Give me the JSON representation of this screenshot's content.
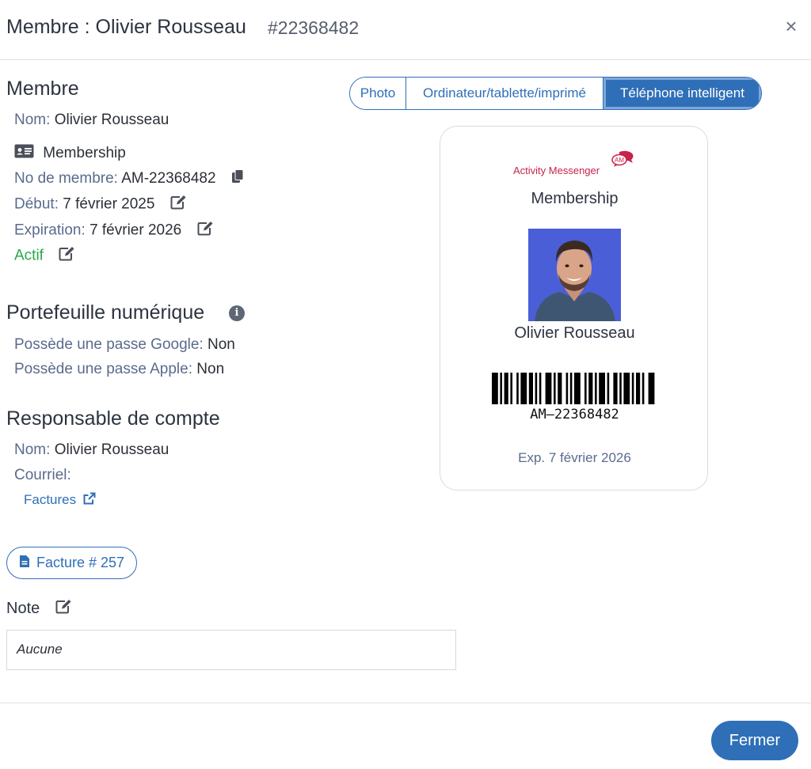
{
  "header": {
    "title": "Membre : Olivier Rousseau",
    "member_id": "#22368482",
    "close_label": "×"
  },
  "member": {
    "section_title": "Membre",
    "name_label": "Nom:",
    "name_value": "Olivier Rousseau",
    "membership_type": "Membership",
    "number_label": "No de membre:",
    "number_value": "AM-22368482",
    "start_label": "Début:",
    "start_value": "7 février 2025",
    "expiration_label": "Expiration:",
    "expiration_value": "7 février 2026",
    "status": "Actif"
  },
  "wallet": {
    "section_title": "Portefeuille numérique",
    "google_label": "Possède une passe Google:",
    "google_value": "Non",
    "apple_label": "Possède une passe Apple:",
    "apple_value": "Non"
  },
  "account_manager": {
    "section_title": "Responsable de compte",
    "name_label": "Nom:",
    "name_value": "Olivier Rousseau",
    "email_label": "Courriel:",
    "invoices_link": "Factures"
  },
  "invoice_button": "Facture # 257",
  "note": {
    "label": "Note",
    "value": "Aucune"
  },
  "view_tabs": [
    {
      "label": "Photo",
      "active": false
    },
    {
      "label": "Ordinateur/tablette/imprimé",
      "active": false
    },
    {
      "label": "Téléphone intelligent",
      "active": true
    }
  ],
  "card": {
    "brand": "Activity Messenger",
    "brand_badge": "AM",
    "title": "Membership",
    "name": "Olivier Rousseau",
    "barcode_text": "AM–22368482",
    "expiration": "Exp. 7 février 2026"
  },
  "footer": {
    "close_button": "Fermer"
  },
  "colors": {
    "primary": "#2f6fb8",
    "label": "#5a6b8c",
    "active_status": "#28a745",
    "brand": "#c8234b"
  }
}
